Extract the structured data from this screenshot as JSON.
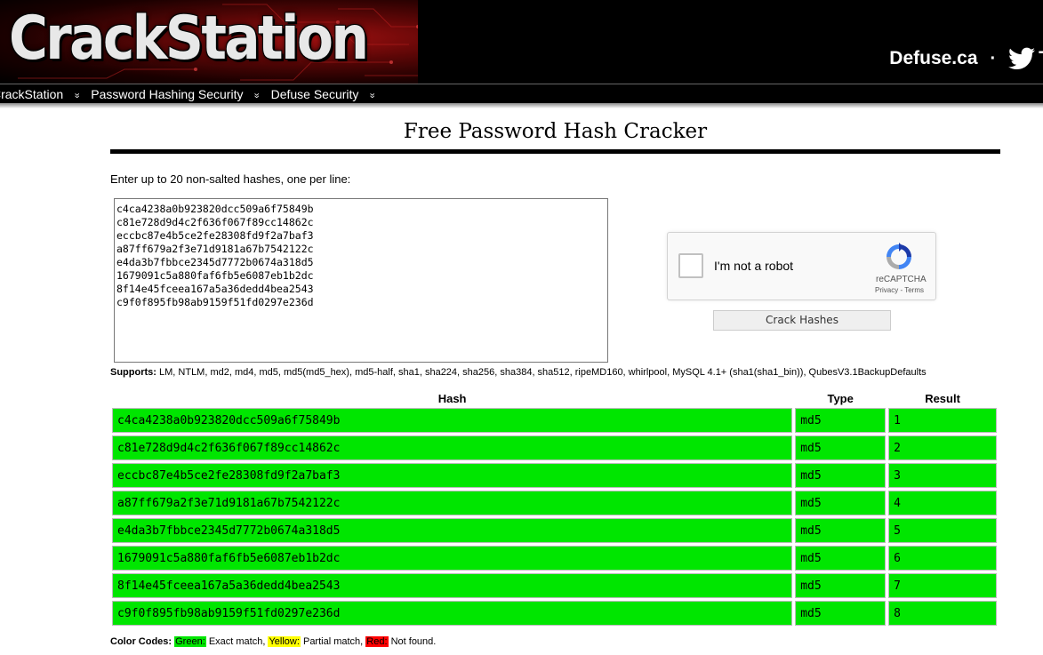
{
  "header": {
    "logo_text": "CrackStation",
    "site_link": "Defuse.ca",
    "separator": "·",
    "twitter_text": "T"
  },
  "nav": {
    "items": [
      {
        "label": "CrackStation"
      },
      {
        "label": "Password Hashing Security"
      },
      {
        "label": "Defuse Security"
      }
    ]
  },
  "main": {
    "title": "Free Password Hash Cracker",
    "instructions": "Enter up to 20 non-salted hashes, one per line:",
    "hash_input_value": "c4ca4238a0b923820dcc509a6f75849b\nc81e728d9d4c2f636f067f89cc14862c\neccbc87e4b5ce2fe28308fd9f2a7baf3\na87ff679a2f3e71d9181a67b7542122c\ne4da3b7fbbce2345d7772b0674a318d5\n1679091c5a880faf6fb5e6087eb1b2dc\n8f14e45fceea167a5a36dedd4bea2543\nc9f0f895fb98ab9159f51fd0297e236d",
    "recaptcha": {
      "label": "I'm not a robot",
      "brand": "reCAPTCHA",
      "privacy": "Privacy",
      "links_sep": " - ",
      "terms": "Terms"
    },
    "crack_button": "Crack Hashes",
    "supports_label": "Supports:",
    "supports_list": " LM, NTLM, md2, md4, md5, md5(md5_hex), md5-half, sha1, sha224, sha256, sha384, sha512, ripeMD160, whirlpool, MySQL 4.1+ (sha1(sha1_bin)), QubesV3.1BackupDefaults"
  },
  "results": {
    "headers": {
      "hash": "Hash",
      "type": "Type",
      "result": "Result"
    },
    "rows": [
      {
        "hash": "c4ca4238a0b923820dcc509a6f75849b",
        "type": "md5",
        "result": "1"
      },
      {
        "hash": "c81e728d9d4c2f636f067f89cc14862c",
        "type": "md5",
        "result": "2"
      },
      {
        "hash": "eccbc87e4b5ce2fe28308fd9f2a7baf3",
        "type": "md5",
        "result": "3"
      },
      {
        "hash": "a87ff679a2f3e71d9181a67b7542122c",
        "type": "md5",
        "result": "4"
      },
      {
        "hash": "e4da3b7fbbce2345d7772b0674a318d5",
        "type": "md5",
        "result": "5"
      },
      {
        "hash": "1679091c5a880faf6fb5e6087eb1b2dc",
        "type": "md5",
        "result": "6"
      },
      {
        "hash": "8f14e45fceea167a5a36dedd4bea2543",
        "type": "md5",
        "result": "7"
      },
      {
        "hash": "c9f0f895fb98ab9159f51fd0297e236d",
        "type": "md5",
        "result": "8"
      }
    ]
  },
  "color_codes": {
    "label": "Color Codes:",
    "green": "Green:",
    "green_desc": " Exact match, ",
    "yellow": "Yellow:",
    "yellow_desc": " Partial match, ",
    "red": "Red:",
    "red_desc": " Not found."
  },
  "colors": {
    "match_green": "#00e600",
    "partial_yellow": "#ffff00",
    "notfound_red": "#ff0000"
  }
}
